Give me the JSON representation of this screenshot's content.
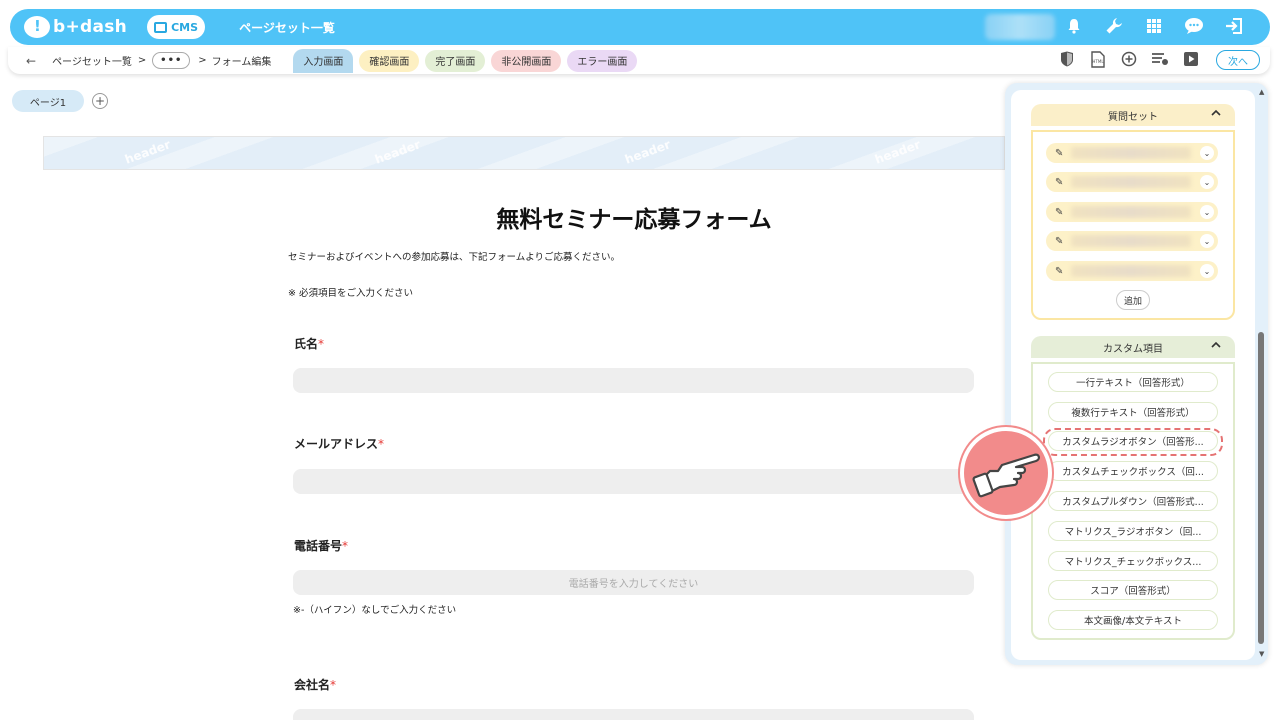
{
  "app": {
    "logo_text": "b+dash",
    "cms_label": "CMS",
    "page_title": "ページセット一覧"
  },
  "top_icons": [
    "bell-icon",
    "wrench-icon",
    "grid-icon",
    "chat-icon",
    "logout-icon"
  ],
  "breadcrumb": {
    "back": "←",
    "item1": "ページセット一覧",
    "sep": ">",
    "more": "•••",
    "item2": "フォーム編集"
  },
  "tabs": {
    "input": "入力画面",
    "confirm": "確認画面",
    "complete": "完了画面",
    "private": "非公開画面",
    "error": "エラー画面"
  },
  "sub_icons": [
    "shield-icon",
    "html-file-icon",
    "add-circle-icon",
    "list-settings-icon",
    "play-icon"
  ],
  "next_label": "次へ",
  "page_tab": "ページ1",
  "page_add": "+",
  "header_watermark": "header",
  "form": {
    "title": "無料セミナー応募フォーム",
    "description": "セミナーおよびイベントへの参加応募は、下記フォームよりご応募ください。",
    "note": "※ 必須項目をご入力ください",
    "required_mark": "*",
    "fields": [
      {
        "label": "氏名",
        "placeholder": ""
      },
      {
        "label": "メールアドレス",
        "placeholder": ""
      },
      {
        "label": "電話番号",
        "placeholder": "電話番号を入力してください",
        "hint": "※-（ハイフン）なしでご入力ください"
      },
      {
        "label": "会社名",
        "placeholder": ""
      }
    ]
  },
  "panel": {
    "question_set": {
      "title": "質問セット",
      "chevron": "^",
      "add_label": "追加"
    },
    "custom_items": {
      "title": "カスタム項目",
      "chevron": "^",
      "items": [
        "一行テキスト（回答形式）",
        "複数行テキスト（回答形式）",
        "カスタムラジオボタン（回答形...",
        "カスタムチェックボックス（回...",
        "カスタムプルダウン（回答形式...",
        "マトリクス_ラジオボタン（回...",
        "マトリクス_チェックボックス...",
        "スコア（回答形式）",
        "本文画像/本文テキスト"
      ]
    }
  },
  "colors": {
    "brand": "#4fc3f7",
    "accent": "#29a8e0",
    "required": "#e53935",
    "highlight": "#e57373"
  }
}
